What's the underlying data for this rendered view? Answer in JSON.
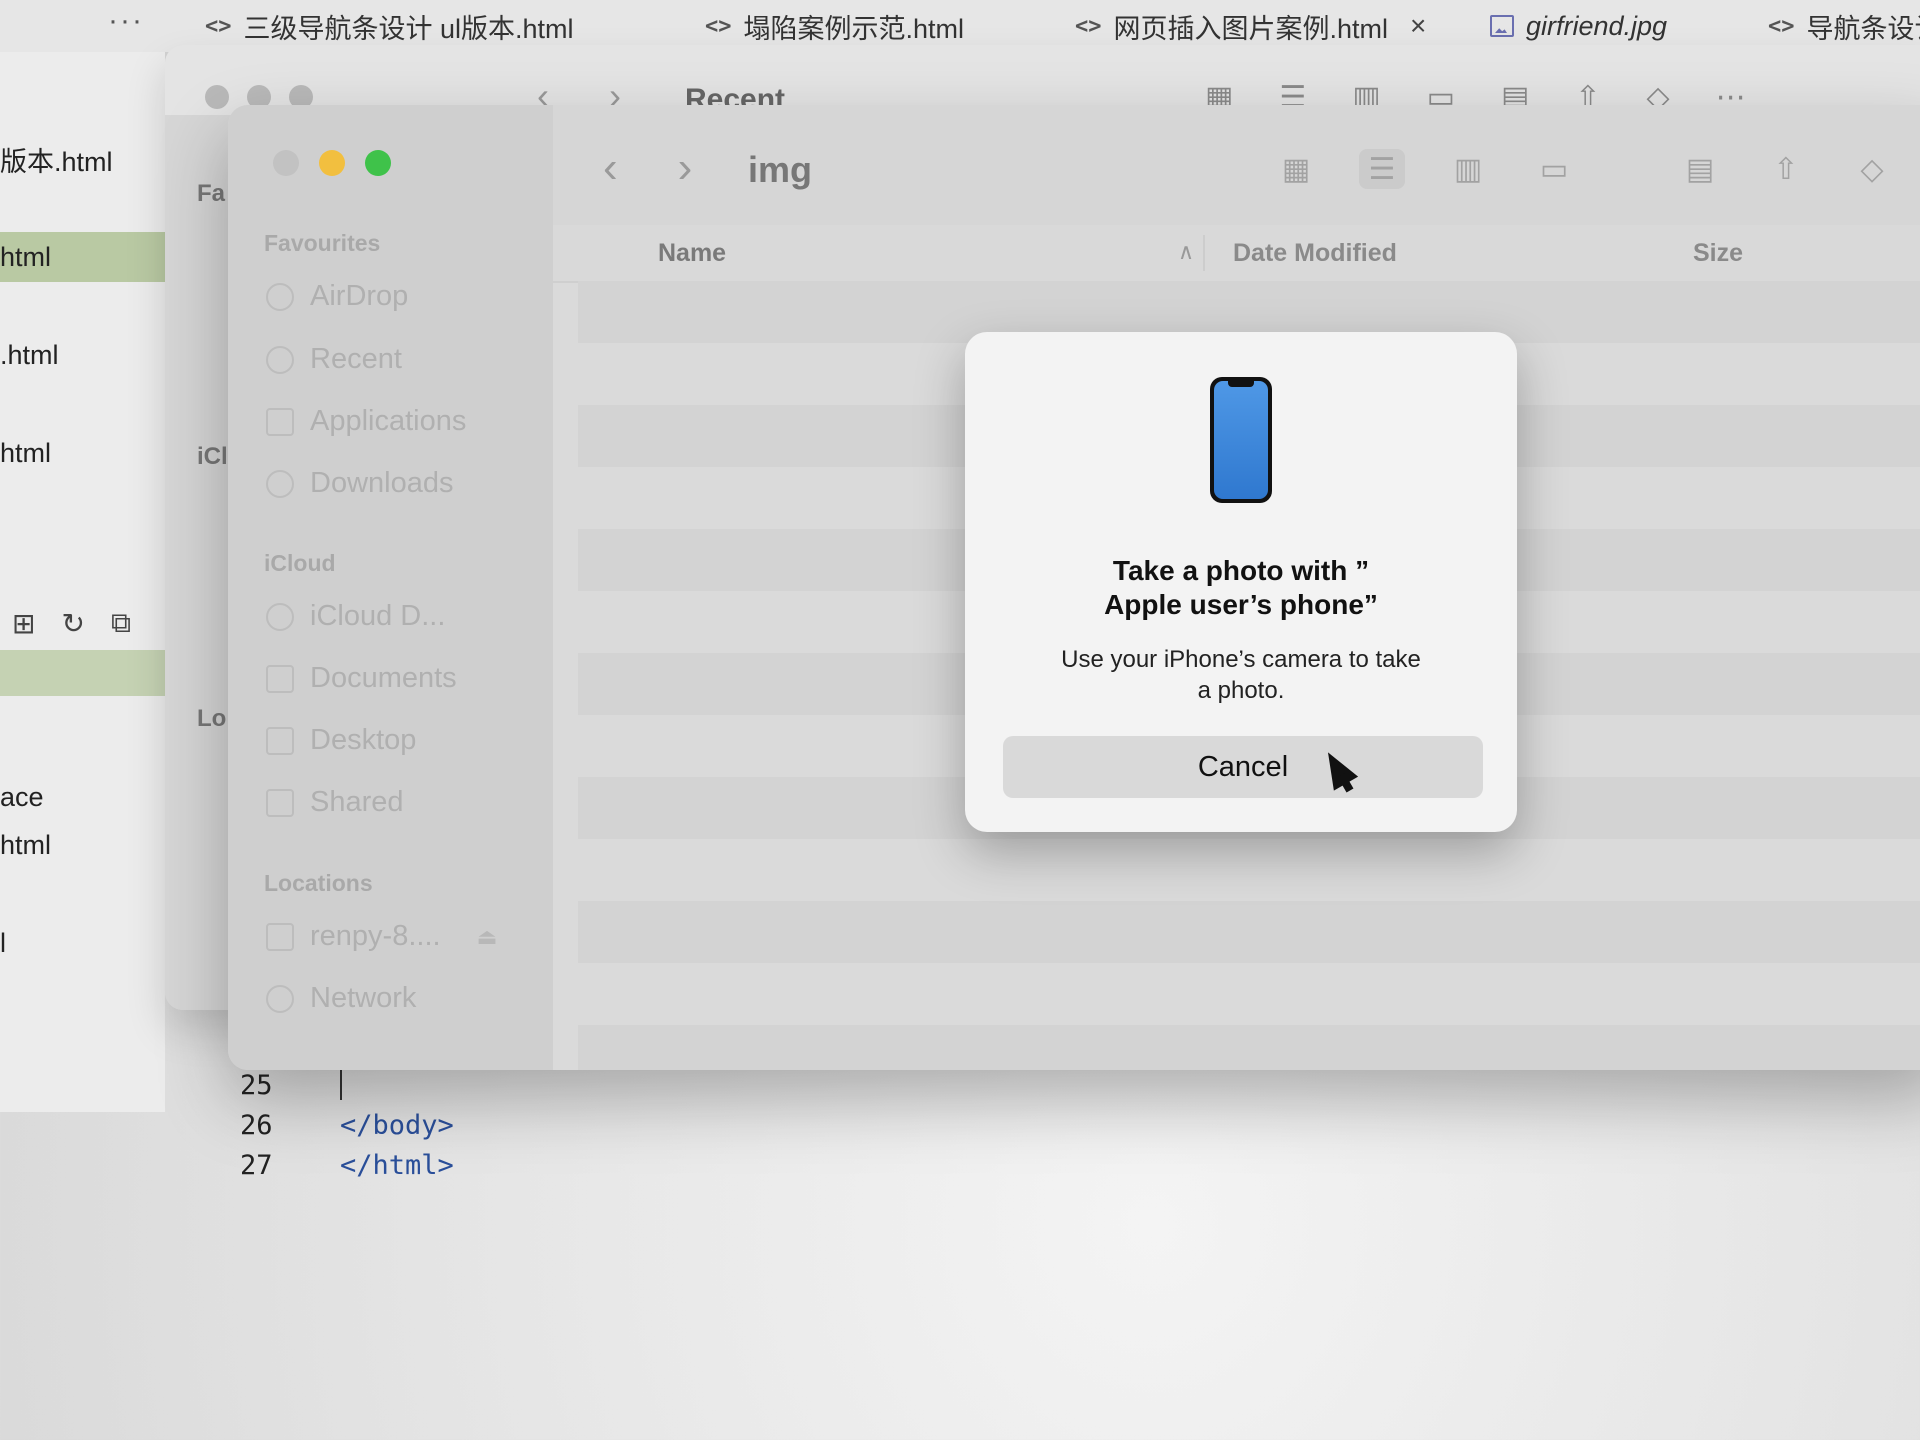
{
  "editor": {
    "more_label": "···",
    "tabs": [
      {
        "label": "三级导航条设计 ul版本.html",
        "icon": "code-file-icon"
      },
      {
        "label": "塌陷案例示范.html",
        "icon": "code-file-icon"
      },
      {
        "label": "网页插入图片案例.html",
        "icon": "code-file-icon",
        "close": "×"
      },
      {
        "label": "girfriend.jpg",
        "icon": "image-file-icon"
      },
      {
        "label": "导航条设计",
        "icon": "code-file-icon"
      }
    ],
    "file_list": [
      "版本.html",
      "html",
      ".html",
      "html",
      "ace",
      "html",
      "l"
    ],
    "code_lines": [
      {
        "num": "25",
        "text": ""
      },
      {
        "num": "26",
        "text": "</body>"
      },
      {
        "num": "27",
        "text": "</html>"
      }
    ]
  },
  "back_window": {
    "title": "Recent",
    "sidebar_labels": [
      "Fa",
      "iCl",
      "Lo"
    ]
  },
  "finder": {
    "title": "img",
    "sidebar": {
      "favourites_header": "Favourites",
      "favourites": [
        {
          "label": "AirDrop",
          "icon": "airdrop-icon"
        },
        {
          "label": "Recent",
          "icon": "clock-icon"
        },
        {
          "label": "Applications",
          "icon": "applications-icon"
        },
        {
          "label": "Downloads",
          "icon": "download-icon"
        }
      ],
      "icloud_header": "iCloud",
      "icloud": [
        {
          "label": "iCloud D...",
          "icon": "cloud-icon"
        },
        {
          "label": "Documents",
          "icon": "document-icon"
        },
        {
          "label": "Desktop",
          "icon": "desktop-icon"
        },
        {
          "label": "Shared",
          "icon": "shared-folder-icon"
        }
      ],
      "locations_header": "Locations",
      "locations": [
        {
          "label": "renpy-8....",
          "icon": "disk-icon"
        },
        {
          "label": "Network",
          "icon": "network-icon"
        }
      ]
    },
    "columns": {
      "name": "Name",
      "date_modified": "Date Modified",
      "size": "Size"
    }
  },
  "dialog": {
    "title_line1": "Take a photo with ”",
    "title_line2": "Apple user’s phone”",
    "message_line1": "Use your iPhone’s camera to take",
    "message_line2": "a photo.",
    "cancel_label": "Cancel"
  },
  "colors": {
    "traffic_close": "#c2c2c2",
    "traffic_minimize": "#f2bf3f",
    "traffic_maximize": "#3fc24a",
    "phone_screen": "#3b86dc",
    "selected_file": "#b9c9a3"
  }
}
